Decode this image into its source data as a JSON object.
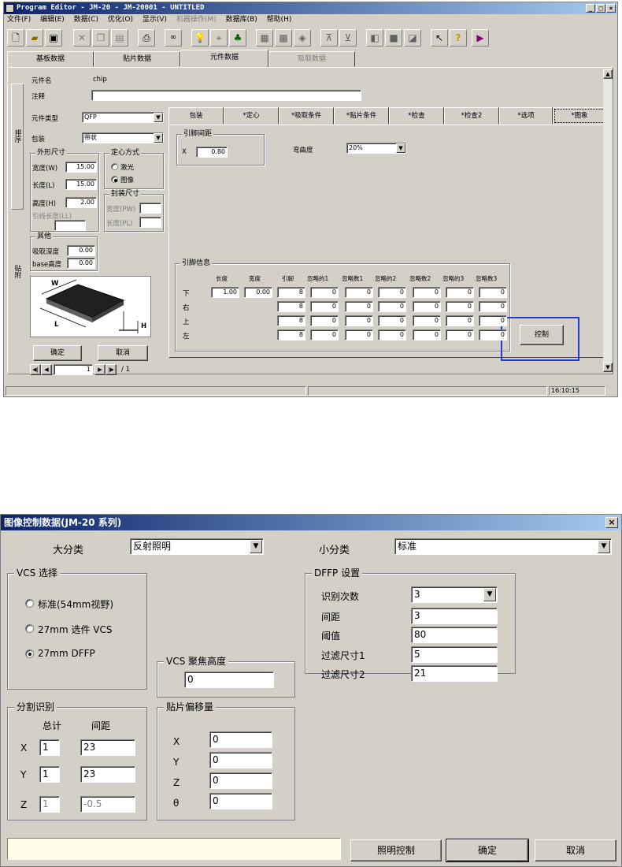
{
  "main_window": {
    "title": "Program Editor - JM-20 - JM-20001 - UNTITLED",
    "title_buttons": [
      "_",
      "□",
      "×"
    ],
    "menu": [
      "文件(F)",
      "编辑(E)",
      "数据(C)",
      "优化(O)",
      "显示(V)",
      "机器操作(M)",
      "数据库(B)",
      "帮助(H)"
    ],
    "toolbar_icons": [
      "new-icon",
      "open-icon",
      "save-icon",
      "cut-icon",
      "copy-icon",
      "paste-icon",
      "print-icon",
      "link-icon",
      "bulb-icon",
      "teach-icon",
      "binoculars-icon",
      "component-icon",
      "feeder-icon",
      "nozzle-icon",
      "align-h-icon",
      "align-v-icon",
      "dock-icon",
      "stop-icon",
      "copy2-icon",
      "help-pointer-icon",
      "help-icon",
      "exit-icon"
    ],
    "tabs": [
      "基板数据",
      "贴片数据",
      "元件数据",
      "吸取数据"
    ],
    "active_tab": 2,
    "side_labels": [
      "排序",
      "贴附"
    ],
    "component_name_label": "元件名",
    "component_name_value": "chip",
    "comment_label": "注释",
    "comment_value": "",
    "component_type_label": "元件类型",
    "component_type_value": "QFP",
    "package_label": "包装",
    "package_value": "带状",
    "outer_size": {
      "title": "外形尺寸",
      "width_label": "宽度(W)",
      "width_value": "15.00",
      "length_label": "长度(L)",
      "length_value": "15.00",
      "height_label": "高度(H)",
      "height_value": "2.00",
      "lead_length_label": "引线长度(LL)",
      "lead_length_value": ""
    },
    "centering": {
      "title": "定心方式",
      "options": [
        "激光",
        "图像"
      ],
      "selected": 1
    },
    "package_size": {
      "title": "封装尺寸",
      "width_label": "宽度(PW)",
      "width_value": "",
      "length_label": "长度(PL)",
      "length_value": ""
    },
    "other": {
      "title": "其他",
      "depth_label": "吸取深度",
      "depth_value": "0.00",
      "base_height_label": "base高度",
      "base_height_value": "0.00"
    },
    "diagram_labels": {
      "w": "W",
      "l": "L",
      "h": "H"
    },
    "ok_label": "确定",
    "cancel_label": "取消",
    "page_current": "1",
    "page_total": "/ 1",
    "sub_tabs": [
      "包装",
      "*定心",
      "*吸取条件",
      "*贴片条件",
      "*检查",
      "*检查2",
      "*选项",
      "*图象"
    ],
    "active_sub_tab": 7,
    "lead_pitch": {
      "title": "引脚间距",
      "x_label": "X",
      "x_value": "0.80"
    },
    "bend_label": "弯曲度",
    "bend_value": "20%",
    "lead_info": {
      "title": "引脚信息",
      "headers": [
        "长度",
        "宽度",
        "引脚",
        "忽略的1",
        "忽略数1",
        "忽略的2",
        "忽略数2",
        "忽略的3",
        "忽略数3"
      ],
      "rows": [
        {
          "side": "下",
          "length": "1.00",
          "width": "0.00",
          "cells": [
            "8",
            "0",
            "0",
            "0",
            "0",
            "0",
            "0"
          ]
        },
        {
          "side": "右",
          "cells": [
            "8",
            "0",
            "0",
            "0",
            "0",
            "0",
            "0"
          ]
        },
        {
          "side": "上",
          "cells": [
            "8",
            "0",
            "0",
            "0",
            "0",
            "0",
            "0"
          ]
        },
        {
          "side": "左",
          "cells": [
            "8",
            "0",
            "0",
            "0",
            "0",
            "0",
            "0"
          ]
        }
      ]
    },
    "control_button": "控制",
    "status_time": "16:10:15"
  },
  "dialog": {
    "title": "图像控制数据(JM-20 系列)",
    "close": "×",
    "major_label": "大分类",
    "major_value": "反射照明",
    "minor_label": "小分类",
    "minor_value": "标准",
    "vcs_select": {
      "title": "VCS 选择",
      "options": [
        "标准(54mm视野)",
        "27mm 选件 VCS",
        "27mm DFFP"
      ],
      "selected": 2
    },
    "dffp": {
      "title": "DFFP 设置",
      "recog_label": "识别次数",
      "recog_value": "3",
      "pitch_label": "间距",
      "pitch_value": "3",
      "threshold_label": "阈值",
      "threshold_value": "80",
      "filter1_label": "过滤尺寸1",
      "filter1_value": "5",
      "filter2_label": "过滤尺寸2",
      "filter2_value": "21"
    },
    "vcs_focus": {
      "title": "VCS 聚焦高度",
      "value": "0"
    },
    "split": {
      "title": "分割识别",
      "total_label": "总计",
      "pitch_label": "间距",
      "x_label": "X",
      "x_total": "1",
      "x_pitch": "23",
      "y_label": "Y",
      "y_total": "1",
      "y_pitch": "23",
      "z_label": "Z",
      "z_total": "1",
      "z_pitch": "-0.5"
    },
    "offset": {
      "title": "贴片偏移量",
      "x_label": "X",
      "x_value": "0",
      "y_label": "Y",
      "y_value": "0",
      "z_label": "Z",
      "z_value": "0",
      "t_label": "θ",
      "t_value": "0"
    },
    "status_text": "",
    "light_button": "照明控制",
    "ok_button": "确定",
    "cancel_button": "取消",
    "highlight_color": "#fffde8"
  }
}
